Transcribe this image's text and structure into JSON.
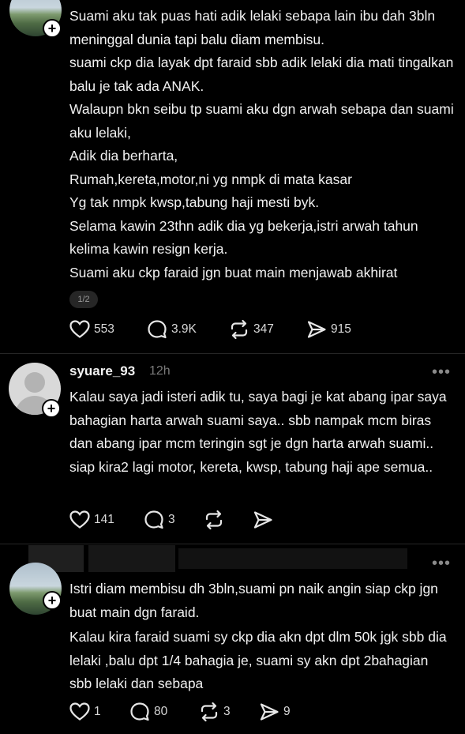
{
  "post1": {
    "lines": [
      "Suami aku tak puas hati adik lelaki sebapa lain ibu dah 3bln meninggal dunia tapi balu diam membisu.",
      "suami ckp dia layak dpt faraid sbb adik lelaki dia mati tingalkan balu je tak ada ANAK.",
      "Walaupn bkn seibu tp suami aku dgn arwah sebapa dan suami aku lelaki,",
      "Adik dia berharta,",
      "Rumah,kereta,motor,ni yg nmpk di mata kasar",
      "Yg tak nmpk kwsp,tabung haji mesti byk.",
      "Selama kawin 23thn adik dia yg bekerja,istri arwah tahun kelima kawin resign kerja.",
      "Suami aku ckp faraid jgn buat main menjawab akhirat"
    ],
    "page_indicator": "1/2",
    "likes": "553",
    "replies": "3.9K",
    "reposts": "347",
    "shares": "915"
  },
  "post2": {
    "username": "syuare_93",
    "time": "12h",
    "more": "•••",
    "text": "Kalau saya jadi isteri adik tu, saya bagi je kat abang ipar saya bahagian harta arwah suami saya.. sbb nampak mcm biras dan abang ipar mcm teringin sgt je dgn harta arwah suami.. siap kira2 lagi motor, kereta, kwsp, tabung haji ape semua..",
    "likes": "141",
    "replies": "3"
  },
  "post3": {
    "more": "•••",
    "lines": [
      "Istri diam membisu dh 3bln,suami pn naik angin siap ckp jgn buat main dgn faraid.",
      "Kalau kira faraid suami sy ckp dia akn dpt dlm 50k jgk sbb dia lelaki ,balu dpt 1/4 bahagia je, suami sy akn dpt 2bahagian sbb lelaki dan sebapa"
    ],
    "likes": "1",
    "replies": "80",
    "reposts": "3",
    "shares": "9"
  },
  "icons": {
    "follow": "+",
    "like": "heart-icon",
    "reply": "comment-icon",
    "repost": "repost-icon",
    "share": "send-icon"
  }
}
